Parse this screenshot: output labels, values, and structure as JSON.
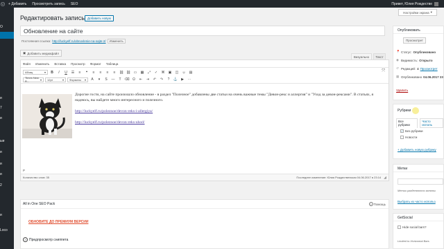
{
  "admin_bar": {
    "items": [
      "Добавить",
      "Просмотреть запись",
      "SEO"
    ],
    "greeting": "Привет, Юлия Рождестве"
  },
  "admin_menu": {
    "items": [
      "О",
      "и",
      "7",
      "и",
      "ыи",
      "и",
      "и",
      "и",
      "2",
      "и",
      "Loco"
    ]
  },
  "screen_options": "Настройки экрана",
  "header": {
    "title": "Редактировать запись",
    "add_new": "Добавить новую"
  },
  "post": {
    "title": "Обновление на сайте",
    "permalink_label": "Постоянная ссылка:",
    "permalink_url": "http://luckyelf.ru/obnovlenie-na-sajte-2/",
    "permalink_edit": "Изменить"
  },
  "editor": {
    "add_media": "Добавить медиафайл",
    "tab_visual": "Визуально",
    "tab_text": "Текст",
    "menubar": [
      "Файл",
      "Изменить",
      "Вставка",
      "Просмотр",
      "Формат",
      "Таблица"
    ],
    "paragraph_select": "Абзац",
    "font_family_select": "Times New R...",
    "font_size_select": "12pt",
    "formats_select": "Форматы",
    "paragraph_1": "Дорогие гости, на сайте произошло обновление - в раздел \"Полезное\" добавлены две статьи на очень важные темы \"Девон-рекс и аллергия\" и \"Уход за девон-рексами\". В статьях, я надеюсь, вы найдете много интересного и полезного.",
    "link_1": "http://luckyelf.ru/poleznoe/devon-reks-i-allergiya/",
    "link_2": "http://luckyelf.ru/poleznoe/devon-reks-uhod/",
    "path": "P",
    "word_count": "Количество слов: 35",
    "last_edit": "Последнее изменение: Юлия Рождественская 04.06.2017 в 23:14"
  },
  "publish_box": {
    "title": "Опубликовать",
    "preview_button": "Просмотрет",
    "status_label": "Статус:",
    "status_value": "Опубликовано",
    "visibility_label": "Видимость:",
    "visibility_value": "Открыто",
    "revisions_label": "Редакций:",
    "revisions_value": "4",
    "revisions_link": "Просмотрет",
    "published_label": "Опубликовано",
    "date": "04.06.2017 23",
    "delete": "Удалить"
  },
  "categories_box": {
    "title": "Рубрики",
    "tab_all": "Все рубрики",
    "tab_popular": "Часто исполь",
    "items": [
      {
        "label": "Без рубрики",
        "checked": true
      },
      {
        "label": "Новости",
        "checked": false
      }
    ],
    "add_link": "+ Добавить новую рубрику"
  },
  "tags_box": {
    "title": "Метки",
    "hint": "Метки разделяются запяты",
    "choose_link": "Выбрать из часто использ"
  },
  "getsocial_box": {
    "title": "GetSocial",
    "hide_label": "Hide social bars?",
    "limited": "Limited to Horizontal Bars"
  },
  "seo_box": {
    "title": "All in One SEO Pack",
    "help": "Помощь",
    "upgrade": "ОБНОВИТЕ ДО ПРЕМИУМ ВЕРСИИ",
    "preview": "Предпросмотр сниппета"
  },
  "colors": {
    "admin_bar": "#23282d",
    "accent": "#0073aa",
    "upgrade": "#e04a2b",
    "delete": "#aa0000"
  }
}
